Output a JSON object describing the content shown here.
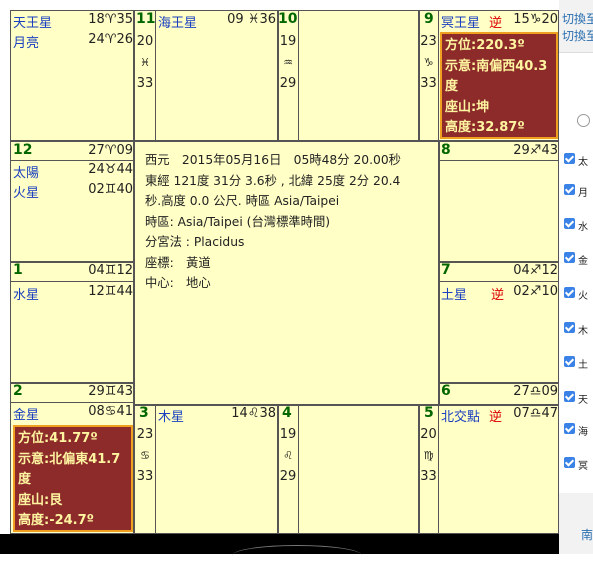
{
  "chart": {
    "h11": {
      "num": "11",
      "planet": "海王星",
      "pos": "09 ♓36",
      "cusp": [
        "20",
        "♓",
        "33"
      ]
    },
    "h10": {
      "num": "10",
      "cusp": [
        "19",
        "♒",
        "29"
      ]
    },
    "h9": {
      "num": "9",
      "planet": "冥王星",
      "retro": "逆",
      "pos": "15♑20",
      "cusp": [
        "23",
        "♑",
        "33"
      ],
      "info": {
        "azimuth": "方位:220.3º",
        "deviation": "示意:南偏西40.3度",
        "mountain": "座山:坤",
        "altitude": "高度:32.87º"
      }
    },
    "h12": {
      "num": "12",
      "cusp": "27♈09",
      "p1": "太陽",
      "p1pos": "24♉44",
      "p2": "火星",
      "p2pos": "02♊40"
    },
    "tl": {
      "p1": "天王星",
      "p1pos": "18♈35",
      "p2": "月亮",
      "p2pos": "24♈26"
    },
    "h8": {
      "num": "8",
      "cusp": "29♐43"
    },
    "h1": {
      "num": "1",
      "cusp": "04♊12",
      "planet": "水星",
      "pos": "12♊44"
    },
    "h7": {
      "num": "7",
      "cusp": "04♐12",
      "planet": "土星",
      "retro": "逆",
      "pos": "02♐10"
    },
    "h2": {
      "num": "2",
      "cusp": "29♊43",
      "planet": "金星",
      "pos": "08♋41",
      "info": {
        "azimuth": "方位:41.77º",
        "deviation": "示意:北偏東41.7度",
        "mountain": "座山:艮",
        "altitude": "高度:-24.7º"
      }
    },
    "h3": {
      "num": "3",
      "planet": "木星",
      "pos": "14♌38",
      "cusp": [
        "23",
        "♋",
        "33"
      ]
    },
    "h4": {
      "num": "4",
      "cusp": [
        "19",
        "♌",
        "29"
      ]
    },
    "h5": {
      "num": "5",
      "planet": "北交點",
      "retro": "逆",
      "pos": "07♎47",
      "cusp": [
        "20",
        "♍",
        "33"
      ]
    },
    "h6": {
      "num": "6",
      "cusp": "27♎09"
    },
    "center": [
      "西元　2015年05月16日　05時48分 20.00秒",
      "東經 121度 31分 3.6秒 , 北緯 25度 2分 20.4",
      "秒.高度 0.0 公尺. 時區 Asia/Taipei",
      "時區: Asia/Taipei (台灣標準時間)",
      "分宮法 : Placidus",
      "座標:　黃道",
      "中心:　地心"
    ]
  },
  "sidebar": {
    "links": [
      "切換至",
      "切換至"
    ],
    "checks": [
      "太",
      "月",
      "水",
      "金",
      "火",
      "木",
      "土",
      "天",
      "海",
      "冥"
    ],
    "footer": "南"
  }
}
